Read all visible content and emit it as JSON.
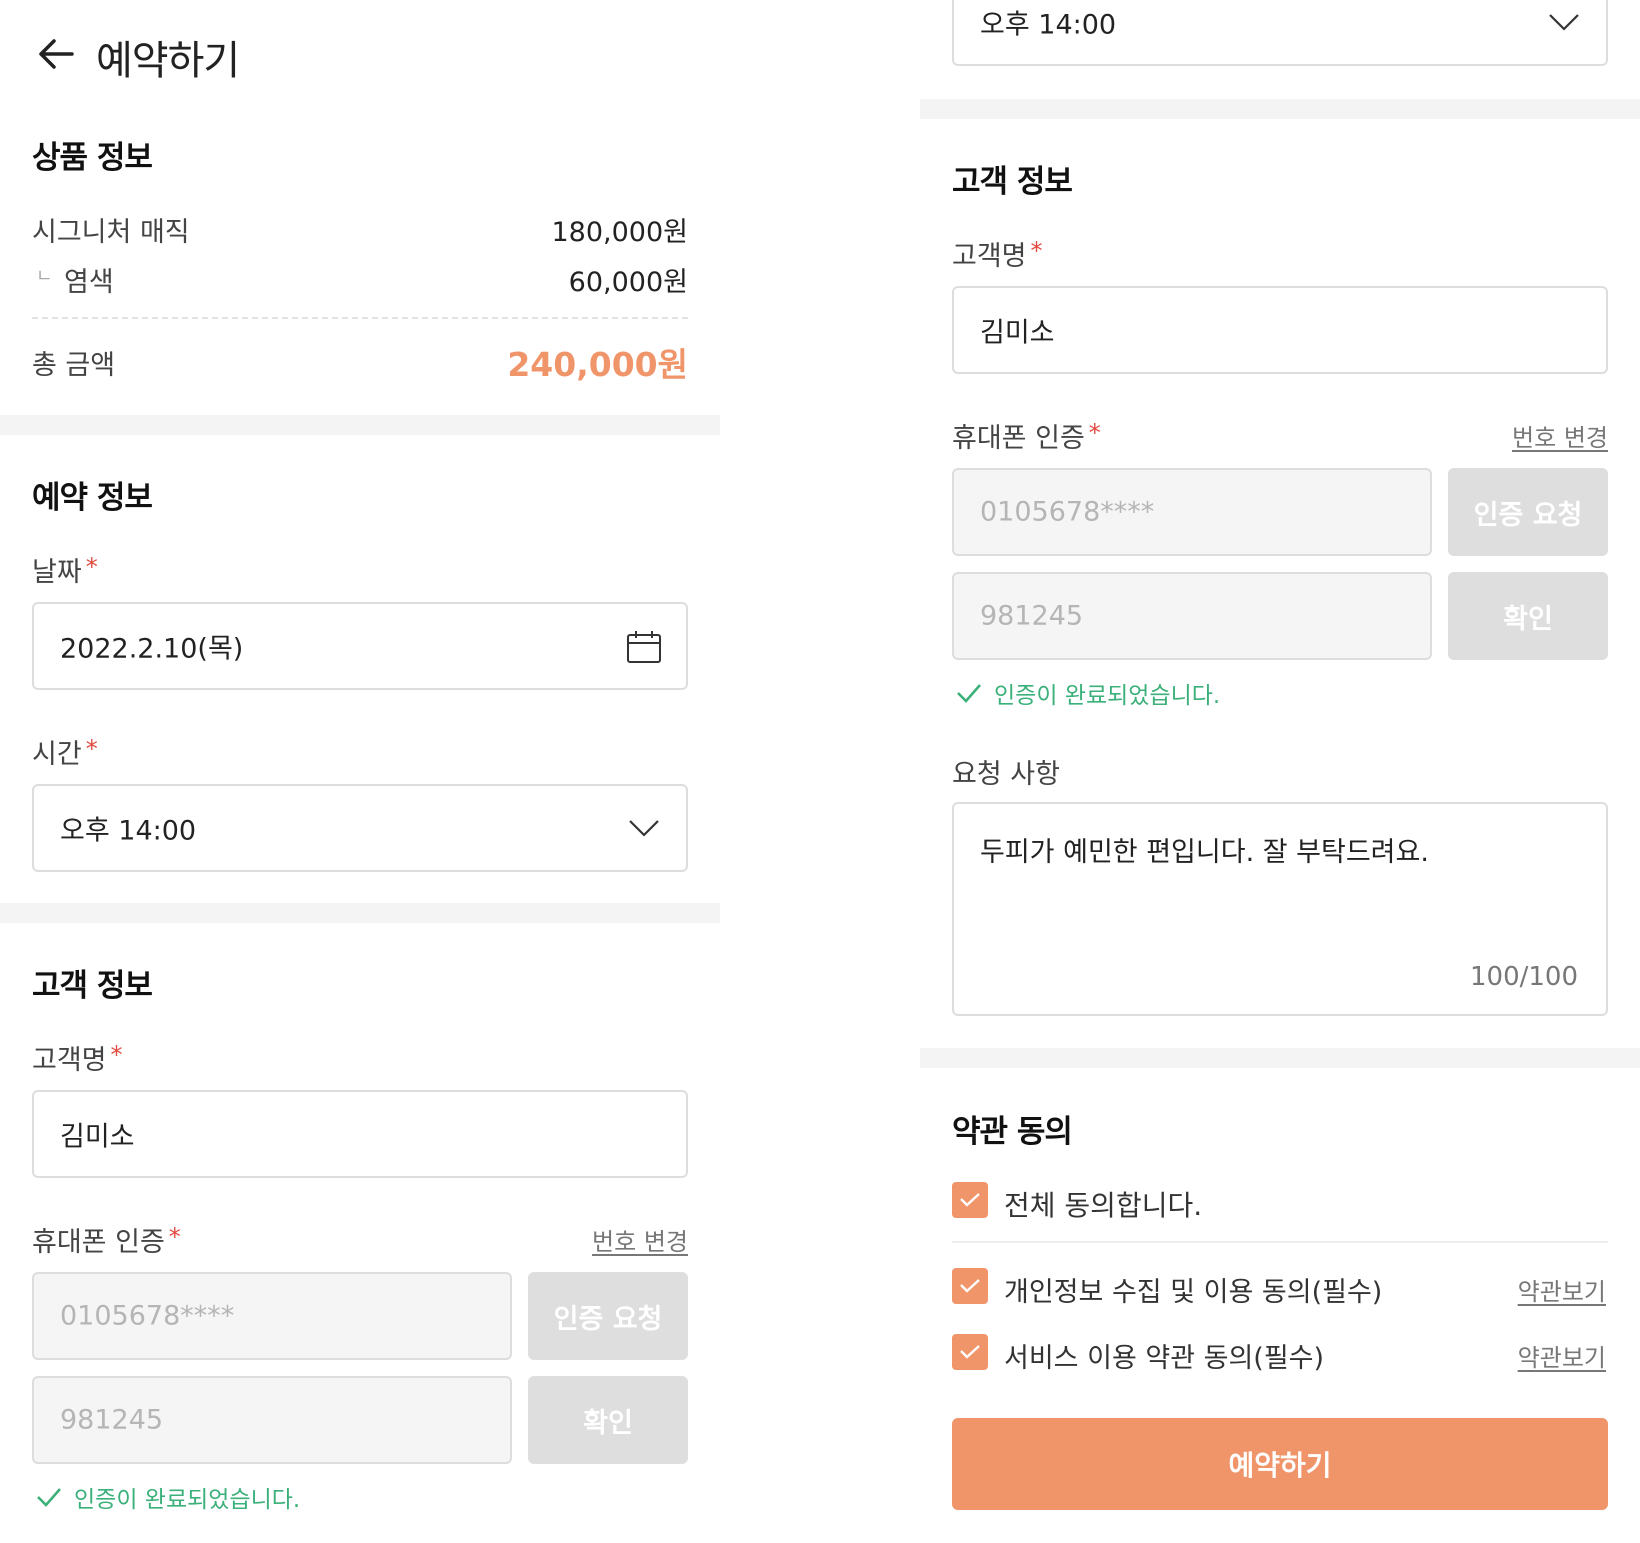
{
  "header": {
    "title": "예약하기"
  },
  "product": {
    "title": "상품 정보",
    "items": [
      {
        "name": "시그니처 매직",
        "price": "180,000원"
      },
      {
        "prefix": "ㄴ",
        "name": "염색",
        "price": "60,000원"
      }
    ],
    "total_label": "총 금액",
    "total_value": "240,000원"
  },
  "reservation": {
    "title": "예약 정보",
    "date_label": "날짜",
    "date_value": "2022.2.10(목)",
    "time_label": "시간",
    "time_value": "오후 14:00"
  },
  "customer": {
    "title": "고객 정보",
    "name_label": "고객명",
    "name_value": "김미소",
    "phone_label": "휴대폰 인증",
    "change_number": "번호 변경",
    "phone_value": "0105678****",
    "request_button": "인증 요청",
    "code_value": "981245",
    "confirm_button": "확인",
    "verified_text": "인증이 완료되었습니다."
  },
  "request": {
    "label": "요청 사항",
    "text": "두피가 예민한 편입니다. 잘 부탁드려요.",
    "counter": "100/100"
  },
  "terms": {
    "title": "약관 동의",
    "all": "전체 동의합니다.",
    "items": [
      {
        "label": "개인정보 수집 및 이용 동의(필수)",
        "link": "약관보기"
      },
      {
        "label": "서비스 이용 약관 동의(필수)",
        "link": "약관보기"
      }
    ]
  },
  "submit": {
    "label": "예약하기"
  },
  "required_mark": "*",
  "colors": {
    "accent": "#f0956a",
    "success": "#3bb07a",
    "required": "#e04a3f"
  }
}
